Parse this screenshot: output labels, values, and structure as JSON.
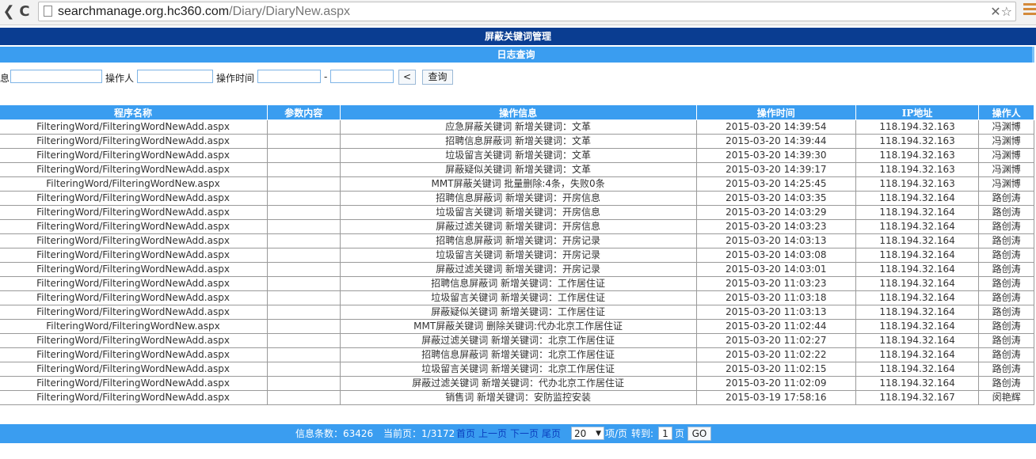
{
  "browser": {
    "url_host": "searchmanage.org.hc360.com",
    "url_path": "/Diary/DiaryNew.aspx",
    "reload_glyph": "C",
    "url_icons": "✕☆"
  },
  "page": {
    "title": "屏蔽关键词管理",
    "subtitle": "日志查询"
  },
  "filters": {
    "info_label": "息",
    "operator_label": "操作人",
    "time_label": "操作时间",
    "range_sep": "-",
    "lt_button": "<",
    "query_button": "查询",
    "info_value": "",
    "operator_value": "",
    "time_from": "",
    "time_to": ""
  },
  "table": {
    "headers": [
      "程序名称",
      "参数内容",
      "操作信息",
      "操作时间",
      "IP地址",
      "操作人"
    ],
    "rows": [
      [
        "FilteringWord/FilteringWordNewAdd.aspx",
        "",
        "应急屏蔽关键词 新增关键词：文革",
        "2015-03-20 14:39:54",
        "118.194.32.163",
        "冯渊博"
      ],
      [
        "FilteringWord/FilteringWordNewAdd.aspx",
        "",
        "招聘信息屏蔽词 新增关键词：文革",
        "2015-03-20 14:39:44",
        "118.194.32.163",
        "冯渊博"
      ],
      [
        "FilteringWord/FilteringWordNewAdd.aspx",
        "",
        "垃圾留言关键词 新增关键词：文革",
        "2015-03-20 14:39:30",
        "118.194.32.163",
        "冯渊博"
      ],
      [
        "FilteringWord/FilteringWordNewAdd.aspx",
        "",
        "屏蔽疑似关键词 新增关键词：文革",
        "2015-03-20 14:39:17",
        "118.194.32.163",
        "冯渊博"
      ],
      [
        "FilteringWord/FilteringWordNew.aspx",
        "",
        "MMT屏蔽关键词 批量删除:4条，失败0条",
        "2015-03-20 14:25:45",
        "118.194.32.163",
        "冯渊博"
      ],
      [
        "FilteringWord/FilteringWordNewAdd.aspx",
        "",
        "招聘信息屏蔽词 新增关键词：开房信息",
        "2015-03-20 14:03:35",
        "118.194.32.164",
        "路创涛"
      ],
      [
        "FilteringWord/FilteringWordNewAdd.aspx",
        "",
        "垃圾留言关键词 新增关键词：开房信息",
        "2015-03-20 14:03:29",
        "118.194.32.164",
        "路创涛"
      ],
      [
        "FilteringWord/FilteringWordNewAdd.aspx",
        "",
        "屏蔽过滤关键词 新增关键词：开房信息",
        "2015-03-20 14:03:23",
        "118.194.32.164",
        "路创涛"
      ],
      [
        "FilteringWord/FilteringWordNewAdd.aspx",
        "",
        "招聘信息屏蔽词 新增关键词：开房记录",
        "2015-03-20 14:03:13",
        "118.194.32.164",
        "路创涛"
      ],
      [
        "FilteringWord/FilteringWordNewAdd.aspx",
        "",
        "垃圾留言关键词 新增关键词：开房记录",
        "2015-03-20 14:03:08",
        "118.194.32.164",
        "路创涛"
      ],
      [
        "FilteringWord/FilteringWordNewAdd.aspx",
        "",
        "屏蔽过滤关键词 新增关键词：开房记录",
        "2015-03-20 14:03:01",
        "118.194.32.164",
        "路创涛"
      ],
      [
        "FilteringWord/FilteringWordNewAdd.aspx",
        "",
        "招聘信息屏蔽词 新增关键词：工作居住证",
        "2015-03-20 11:03:23",
        "118.194.32.164",
        "路创涛"
      ],
      [
        "FilteringWord/FilteringWordNewAdd.aspx",
        "",
        "垃圾留言关键词 新增关键词：工作居住证",
        "2015-03-20 11:03:18",
        "118.194.32.164",
        "路创涛"
      ],
      [
        "FilteringWord/FilteringWordNewAdd.aspx",
        "",
        "屏蔽疑似关键词 新增关键词：工作居住证",
        "2015-03-20 11:03:13",
        "118.194.32.164",
        "路创涛"
      ],
      [
        "FilteringWord/FilteringWordNew.aspx",
        "",
        "MMT屏蔽关键词 删除关键词:代办北京工作居住证",
        "2015-03-20 11:02:44",
        "118.194.32.164",
        "路创涛"
      ],
      [
        "FilteringWord/FilteringWordNewAdd.aspx",
        "",
        "屏蔽过滤关键词 新增关键词：北京工作居住证",
        "2015-03-20 11:02:27",
        "118.194.32.164",
        "路创涛"
      ],
      [
        "FilteringWord/FilteringWordNewAdd.aspx",
        "",
        "招聘信息屏蔽词 新增关键词：北京工作居住证",
        "2015-03-20 11:02:22",
        "118.194.32.164",
        "路创涛"
      ],
      [
        "FilteringWord/FilteringWordNewAdd.aspx",
        "",
        "垃圾留言关键词 新增关键词：北京工作居住证",
        "2015-03-20 11:02:15",
        "118.194.32.164",
        "路创涛"
      ],
      [
        "FilteringWord/FilteringWordNewAdd.aspx",
        "",
        "屏蔽过滤关键词 新增关键词：代办北京工作居住证",
        "2015-03-20 11:02:09",
        "118.194.32.164",
        "路创涛"
      ],
      [
        "FilteringWord/FilteringWordNewAdd.aspx",
        "",
        "销售词 新增关键词：安防监控安装",
        "2015-03-19 17:58:16",
        "118.194.32.167",
        "闵艳辉"
      ]
    ]
  },
  "pager": {
    "total_label": "信息条数：",
    "total_value": "63426",
    "current_label": "当前页：",
    "current_value": "1/3172",
    "first": "首页",
    "prev": "上一页",
    "next": "下一页",
    "last": "尾页",
    "page_size": "20",
    "per_page_label": "项/页",
    "goto_label": "转到:",
    "goto_value": "1",
    "page_unit": "页",
    "go_button": "GO"
  },
  "colors": {
    "title_bar": "#0a3d91",
    "header_blue": "#3a9df0",
    "link_blue": "#0b3fbf"
  }
}
